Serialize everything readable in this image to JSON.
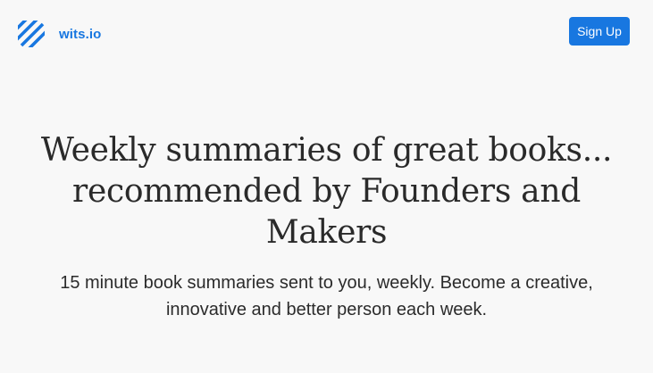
{
  "brand": {
    "name": "wits.io",
    "logo_icon": "striped-diagonal-logo-icon",
    "color": "#1877e0"
  },
  "navbar": {
    "signup_label": "Sign Up"
  },
  "hero": {
    "headline": "Weekly summaries of great books... recommended by Founders and Makers",
    "subheadline": "15 minute book summaries sent to you, weekly. Become a creative, innovative and better person each week."
  },
  "colors": {
    "accent": "#1877e0",
    "background": "#f8f8f8",
    "text": "#2b2b2b"
  }
}
